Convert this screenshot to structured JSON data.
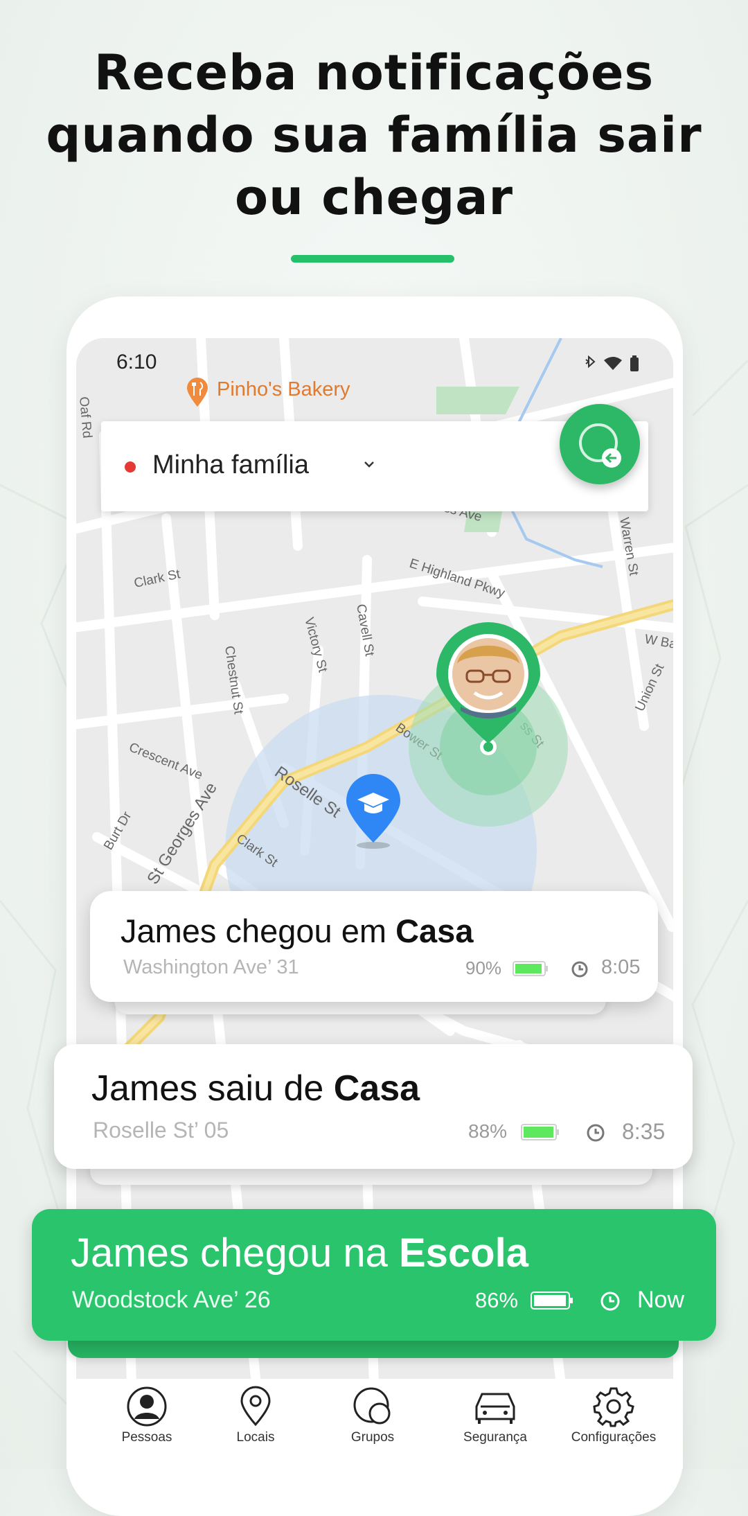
{
  "headline": {
    "line1": "Receba notificações",
    "line2": "quando sua família sair",
    "line3": "ou chegar"
  },
  "status": {
    "time": "6:10"
  },
  "map": {
    "place_label": "Pinho's Bakery",
    "streets": [
      "Clark St",
      "E Highland Pkwy",
      "Victory St",
      "Cavell St",
      "Chestnut St",
      "Bower St",
      "Crescent Ave",
      "Roselle St",
      "St Georges Ave",
      "Clark St",
      "Burt Dr",
      "Warren St",
      "Union St",
      "W Ba",
      "Ross St",
      "Oaf Rd",
      "ss Ave"
    ]
  },
  "family": {
    "label": "Minha família"
  },
  "notifications": [
    {
      "prefix": "James chegou em ",
      "place": "Casa",
      "address": "Washington Ave’ 31",
      "battery": "90%",
      "time": "8:05"
    },
    {
      "prefix": "James saiu de ",
      "place": "Casa",
      "address": "Roselle St’ 05",
      "battery": "88%",
      "time": "8:35"
    },
    {
      "prefix": "James chegou na ",
      "place": "Escola",
      "address": "Woodstock Ave’ 26",
      "battery": "86%",
      "time": "Now"
    }
  ],
  "tabs": [
    {
      "label": "Pessoas",
      "icon": "person-icon"
    },
    {
      "label": "Locais",
      "icon": "location-pin-icon"
    },
    {
      "label": "Grupos",
      "icon": "groups-icon"
    },
    {
      "label": "Segurança",
      "icon": "car-icon"
    },
    {
      "label": "Configurações",
      "icon": "gear-icon"
    }
  ],
  "colors": {
    "accent": "#27c06a",
    "marker_green": "#2cb866",
    "school_blue": "#2f86f5",
    "alert_red": "#e53935"
  }
}
